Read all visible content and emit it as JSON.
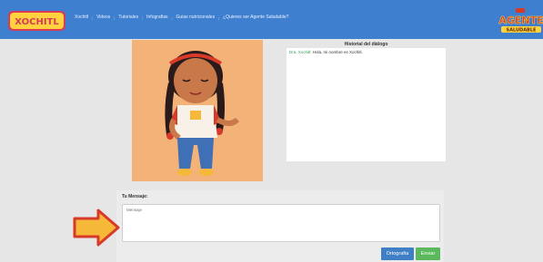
{
  "colors": {
    "nav_bg": "#3f7fcf",
    "page_bg": "#e6e6e6",
    "illustration_bg": "#f3b277",
    "ortho_btn": "#3e7fc5",
    "send_btn": "#5cb85c",
    "arrow_fill": "#f6b838",
    "arrow_stroke": "#d83a2a"
  },
  "brand": {
    "left_logo": "XOCHITL",
    "right_logo": "AGENTE",
    "right_logo_sub": "SALUDABLE"
  },
  "nav": {
    "items": [
      "Xochitl",
      "Videos",
      "Tutoriales",
      "Infografias",
      "Guias nutricionales",
      "¿Quieres ser Agente Saludable?"
    ]
  },
  "history": {
    "title": "Historial del diálogo",
    "messages": [
      {
        "speaker": "Dra. Xochitl:",
        "text": "Hola, mi nombre es Xochitl."
      }
    ]
  },
  "form": {
    "label": "Tu Mensaje:",
    "placeholder": "Mensaje",
    "spell_button": "Ortografía",
    "send_button": "Enviar"
  },
  "icons": {
    "arrow": "right-arrow-icon"
  }
}
